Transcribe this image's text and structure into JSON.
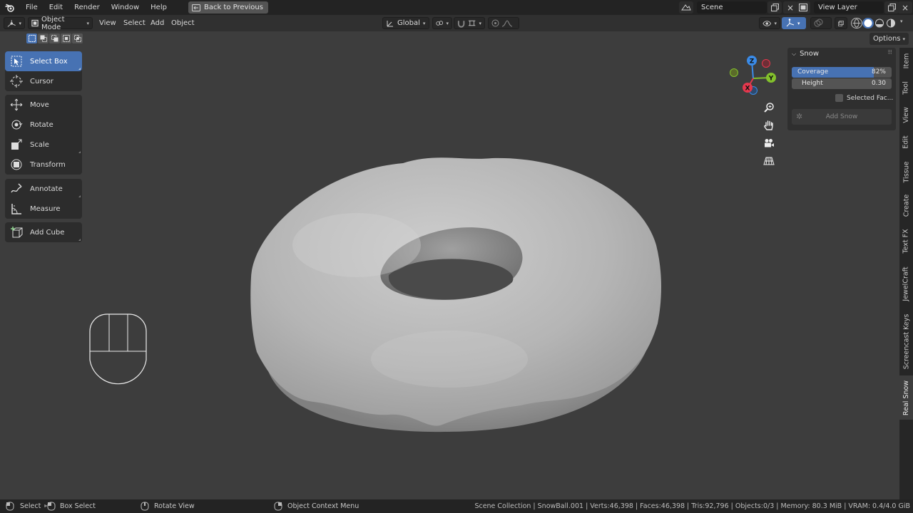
{
  "topbar": {
    "menus": [
      "File",
      "Edit",
      "Render",
      "Window",
      "Help"
    ],
    "back_button": "Back to Previous",
    "scene_name": "Scene",
    "view_layer": "View Layer"
  },
  "header": {
    "mode": "Object Mode",
    "menus": [
      "View",
      "Select",
      "Add",
      "Object"
    ],
    "transform_orientation": "Global",
    "options_button": "Options"
  },
  "toolbar": {
    "tools": [
      {
        "label": "Select Box",
        "icon": "select-box-icon",
        "active": true
      },
      {
        "label": "Cursor",
        "icon": "cursor-icon"
      },
      {
        "label": "Move",
        "icon": "move-icon"
      },
      {
        "label": "Rotate",
        "icon": "rotate-icon"
      },
      {
        "label": "Scale",
        "icon": "scale-icon"
      },
      {
        "label": "Transform",
        "icon": "transform-icon"
      },
      {
        "label": "Annotate",
        "icon": "annotate-icon"
      },
      {
        "label": "Measure",
        "icon": "measure-icon"
      },
      {
        "label": "Add Cube",
        "icon": "add-cube-icon"
      }
    ]
  },
  "gizmo": {
    "x": "X",
    "y": "Y",
    "z": "Z"
  },
  "snow_panel": {
    "title": "Snow",
    "coverage_label": "Coverage",
    "coverage_value": "82%",
    "coverage_fraction": 0.82,
    "height_label": "Height",
    "height_value": "0.30",
    "selected_faces_label": "Selected Fac...",
    "selected_faces_checked": false,
    "add_snow_button": "Add Snow"
  },
  "side_tabs": [
    {
      "label": "Item"
    },
    {
      "label": "Tool"
    },
    {
      "label": "View"
    },
    {
      "label": "Edit"
    },
    {
      "label": "Tissue"
    },
    {
      "label": "Create"
    },
    {
      "label": "Text FX"
    },
    {
      "label": "JewelCraft"
    },
    {
      "label": "Screencast Keys"
    },
    {
      "label": "Real Snow",
      "active": true
    }
  ],
  "statusbar": {
    "select": "Select",
    "box_select": "Box Select",
    "rotate_view": "Rotate View",
    "context_menu": "Object Context Menu",
    "stats": "Scene Collection | SnowBall.001 | Verts:46,398 | Faces:46,398 | Tris:92,796 | Objects:0/3 | Memory: 80.3 MiB | VRAM: 0.4/4.0 GiB"
  },
  "colors": {
    "accent": "#4772b3",
    "background": "#3d3d3d",
    "topbar": "#232323",
    "gizmo_x": "#e5384d",
    "gizmo_y": "#83c12c",
    "gizmo_z": "#3a8be8"
  }
}
